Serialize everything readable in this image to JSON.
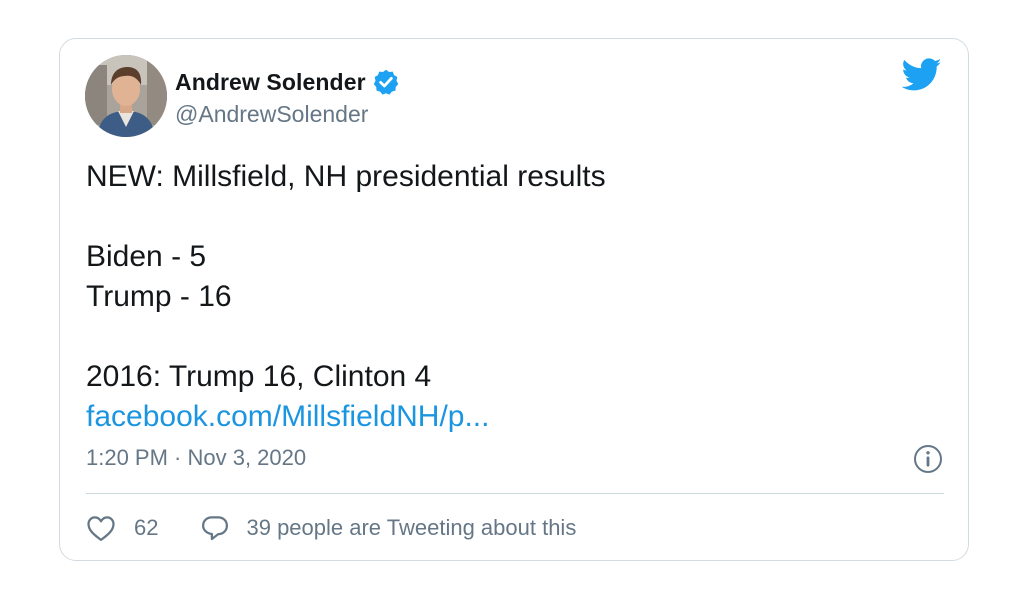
{
  "author": {
    "display_name": "Andrew Solender",
    "handle": "@AndrewSolender",
    "verified": true,
    "avatar": "profile-photo"
  },
  "tweet": {
    "lines": [
      "NEW: Millsfield, NH presidential results",
      "Biden - 5",
      "Trump - 16",
      "2016: Trump 16, Clinton 4"
    ],
    "link_text": "facebook.com/MillsfieldNH/p..."
  },
  "meta": {
    "timestamp": "1:20 PM · Nov 3, 2020"
  },
  "engagement": {
    "like_count": "62",
    "reply_label": "39 people are Tweeting about this"
  },
  "icons": {
    "brand": "twitter-bird-icon",
    "verified": "verified-badge-icon",
    "info": "info-icon",
    "like": "heart-icon",
    "reply": "speech-bubble-icon"
  },
  "colors": {
    "brand_blue": "#1da1f2",
    "link_blue": "#1b95e0",
    "text": "#14171a",
    "secondary_text": "#657786",
    "border": "#d3dbe2"
  }
}
